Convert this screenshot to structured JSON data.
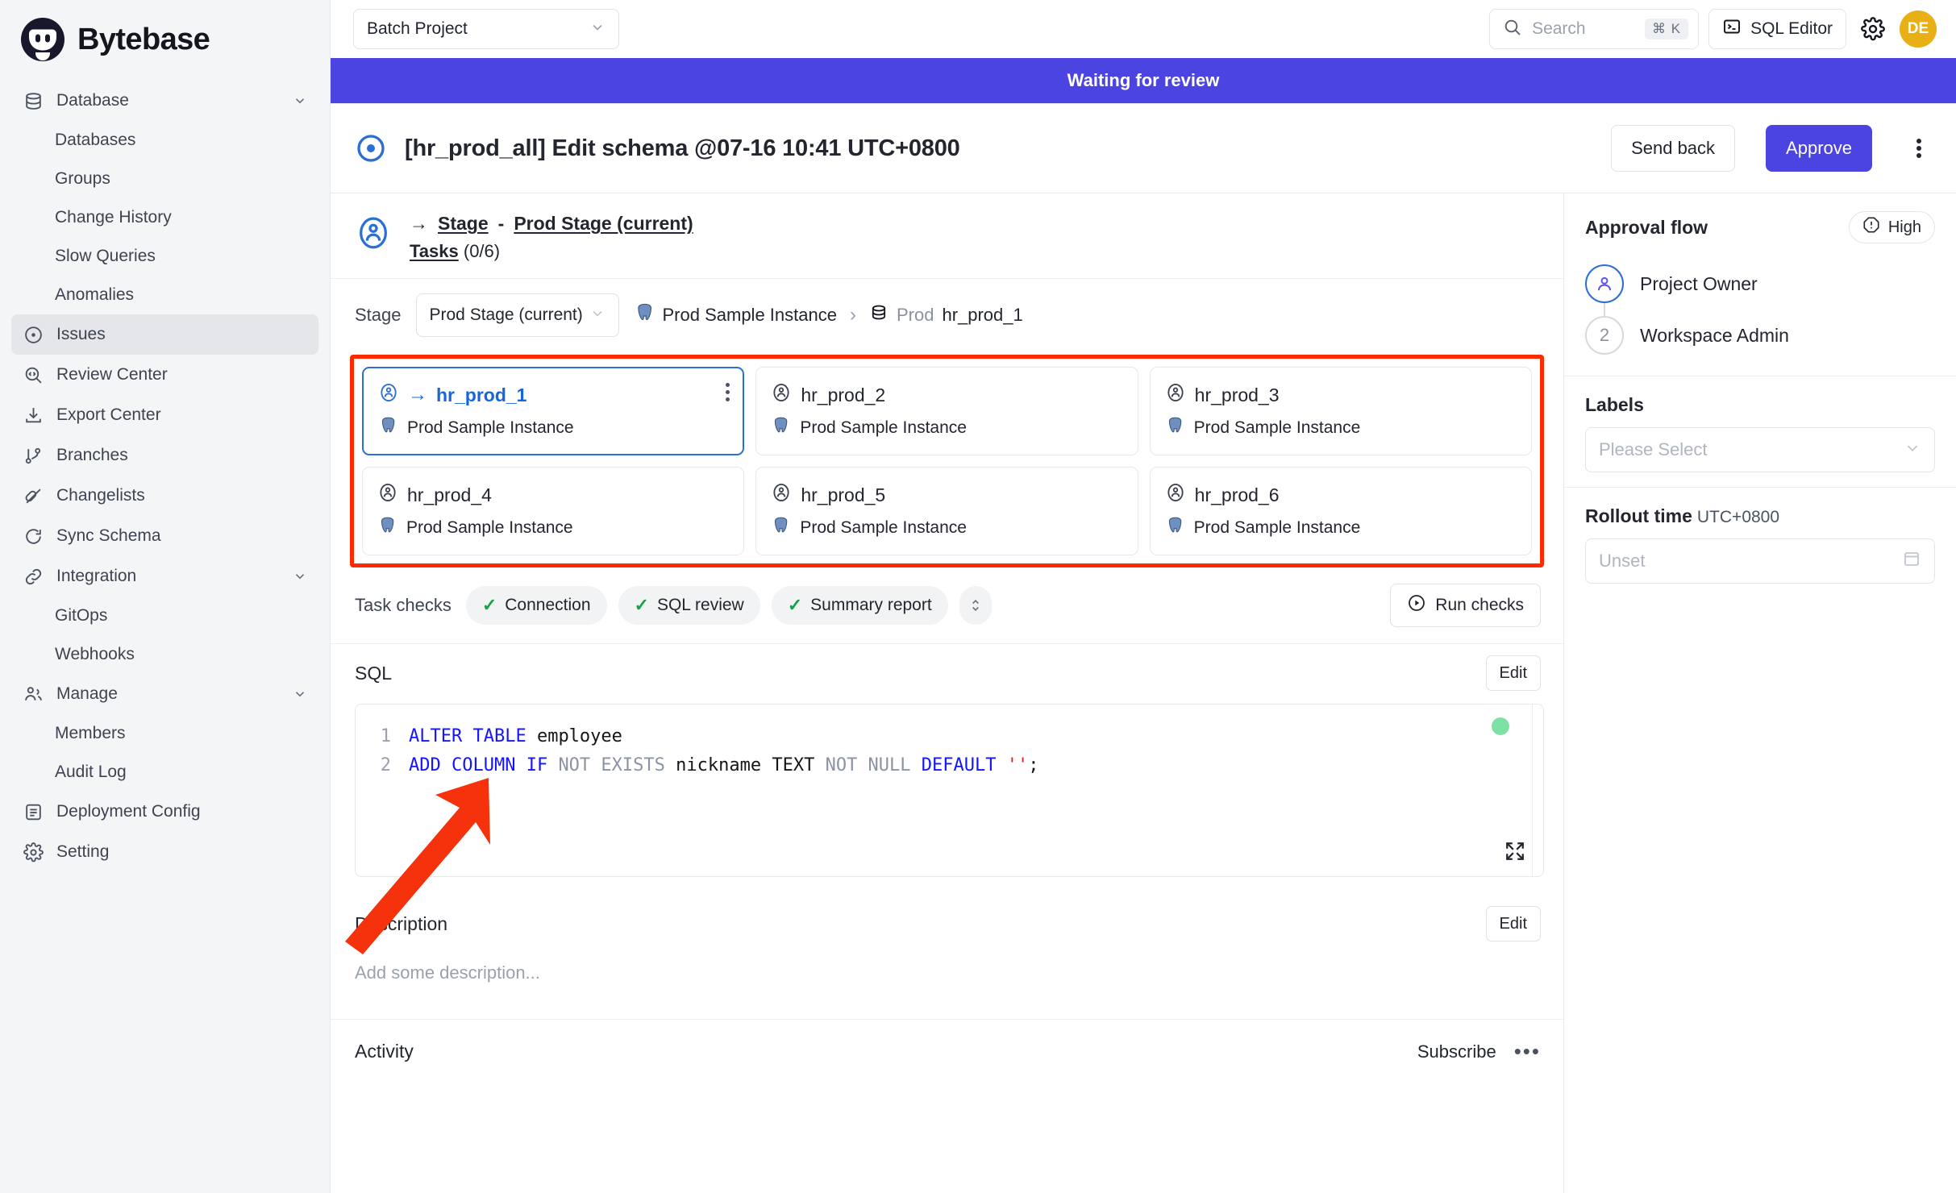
{
  "brand": {
    "name": "Bytebase"
  },
  "sidebar": {
    "items": [
      {
        "label": "Database",
        "icon": "database-icon",
        "type": "group",
        "expanded": true
      },
      {
        "label": "Databases",
        "icon": "",
        "type": "sub"
      },
      {
        "label": "Groups",
        "icon": "",
        "type": "sub"
      },
      {
        "label": "Change History",
        "icon": "",
        "type": "sub"
      },
      {
        "label": "Slow Queries",
        "icon": "",
        "type": "sub"
      },
      {
        "label": "Anomalies",
        "icon": "",
        "type": "sub"
      },
      {
        "label": "Issues",
        "icon": "issues-icon",
        "type": "item",
        "active": true
      },
      {
        "label": "Review Center",
        "icon": "review-center-icon",
        "type": "item"
      },
      {
        "label": "Export Center",
        "icon": "export-center-icon",
        "type": "item"
      },
      {
        "label": "Branches",
        "icon": "branches-icon",
        "type": "item"
      },
      {
        "label": "Changelists",
        "icon": "changelists-icon",
        "type": "item"
      },
      {
        "label": "Sync Schema",
        "icon": "sync-schema-icon",
        "type": "item"
      },
      {
        "label": "Integration",
        "icon": "integration-icon",
        "type": "group",
        "expanded": true
      },
      {
        "label": "GitOps",
        "icon": "",
        "type": "sub"
      },
      {
        "label": "Webhooks",
        "icon": "",
        "type": "sub"
      },
      {
        "label": "Manage",
        "icon": "manage-icon",
        "type": "group",
        "expanded": true
      },
      {
        "label": "Members",
        "icon": "",
        "type": "sub"
      },
      {
        "label": "Audit Log",
        "icon": "",
        "type": "sub"
      },
      {
        "label": "Deployment Config",
        "icon": "deployment-config-icon",
        "type": "item"
      },
      {
        "label": "Setting",
        "icon": "setting-icon",
        "type": "item"
      }
    ]
  },
  "topbar": {
    "project": "Batch Project",
    "search_placeholder": "Search",
    "search_shortcut": "⌘ K",
    "sql_editor_label": "SQL Editor",
    "avatar_initials": "DE"
  },
  "banner": {
    "text": "Waiting for review"
  },
  "issue": {
    "title": "[hr_prod_all] Edit schema @07-16 10:41 UTC+0800",
    "send_back_label": "Send back",
    "approve_label": "Approve"
  },
  "stage": {
    "arrow": "→",
    "stage_word": "Stage",
    "dash": "-",
    "stage_name": "Prod Stage (current)",
    "tasks_word": "Tasks",
    "tasks_count": "(0/6)",
    "stage_label": "Stage",
    "stage_value": "Prod Stage (current)",
    "breadcrumb_instance": "Prod Sample Instance",
    "breadcrumb_env": "Prod",
    "breadcrumb_db": "hr_prod_1"
  },
  "tasks": [
    {
      "name": "hr_prod_1",
      "instance": "Prod Sample Instance",
      "selected": true
    },
    {
      "name": "hr_prod_2",
      "instance": "Prod Sample Instance",
      "selected": false
    },
    {
      "name": "hr_prod_3",
      "instance": "Prod Sample Instance",
      "selected": false
    },
    {
      "name": "hr_prod_4",
      "instance": "Prod Sample Instance",
      "selected": false
    },
    {
      "name": "hr_prod_5",
      "instance": "Prod Sample Instance",
      "selected": false
    },
    {
      "name": "hr_prod_6",
      "instance": "Prod Sample Instance",
      "selected": false
    }
  ],
  "checks": {
    "label": "Task checks",
    "items": [
      {
        "label": "Connection",
        "status": "passed"
      },
      {
        "label": "SQL review",
        "status": "passed"
      },
      {
        "label": "Summary report",
        "status": "passed"
      }
    ],
    "run_checks_label": "Run checks"
  },
  "sql": {
    "section_title": "SQL",
    "edit_label": "Edit",
    "lines": [
      {
        "no": "1",
        "tokens": [
          {
            "t": "ALTER",
            "c": "kw"
          },
          {
            "t": " ",
            "c": "plain"
          },
          {
            "t": "TABLE",
            "c": "kw"
          },
          {
            "t": " employee",
            "c": "plain"
          }
        ]
      },
      {
        "no": "2",
        "tokens": [
          {
            "t": "ADD",
            "c": "kw"
          },
          {
            "t": " ",
            "c": "plain"
          },
          {
            "t": "COLUMN",
            "c": "kw"
          },
          {
            "t": " ",
            "c": "plain"
          },
          {
            "t": "IF",
            "c": "kw"
          },
          {
            "t": " ",
            "c": "plain"
          },
          {
            "t": "NOT",
            "c": "kw2"
          },
          {
            "t": " ",
            "c": "plain"
          },
          {
            "t": "EXISTS",
            "c": "kw2"
          },
          {
            "t": " nickname TEXT ",
            "c": "plain"
          },
          {
            "t": "NOT",
            "c": "kw2"
          },
          {
            "t": " ",
            "c": "plain"
          },
          {
            "t": "NULL",
            "c": "kw2"
          },
          {
            "t": " ",
            "c": "plain"
          },
          {
            "t": "DEFAULT",
            "c": "kw"
          },
          {
            "t": " ",
            "c": "plain"
          },
          {
            "t": "''",
            "c": "str"
          },
          {
            "t": ";",
            "c": "plain"
          }
        ]
      }
    ]
  },
  "description": {
    "section_title": "Description",
    "edit_label": "Edit",
    "placeholder": "Add some description..."
  },
  "activity": {
    "section_title": "Activity",
    "subscribe_label": "Subscribe",
    "more_label": "•••"
  },
  "right": {
    "approval_title": "Approval flow",
    "risk_label": "High",
    "flow": [
      {
        "label": "Project Owner",
        "badge": "",
        "active": true
      },
      {
        "label": "Workspace Admin",
        "badge": "2",
        "active": false
      }
    ],
    "labels_title": "Labels",
    "labels_placeholder": "Please Select",
    "rollout_title": "Rollout time",
    "rollout_tz": "UTC+0800",
    "rollout_placeholder": "Unset"
  },
  "colors": {
    "accent": "#4b44e0",
    "banner": "#4b44e0",
    "selected_card_border": "#2b6fd6",
    "annotation_red": "#ff2a00",
    "avatar_yellow": "#e8b016",
    "check_green": "#16a34a",
    "status_dot_green": "#7fe0a4"
  }
}
